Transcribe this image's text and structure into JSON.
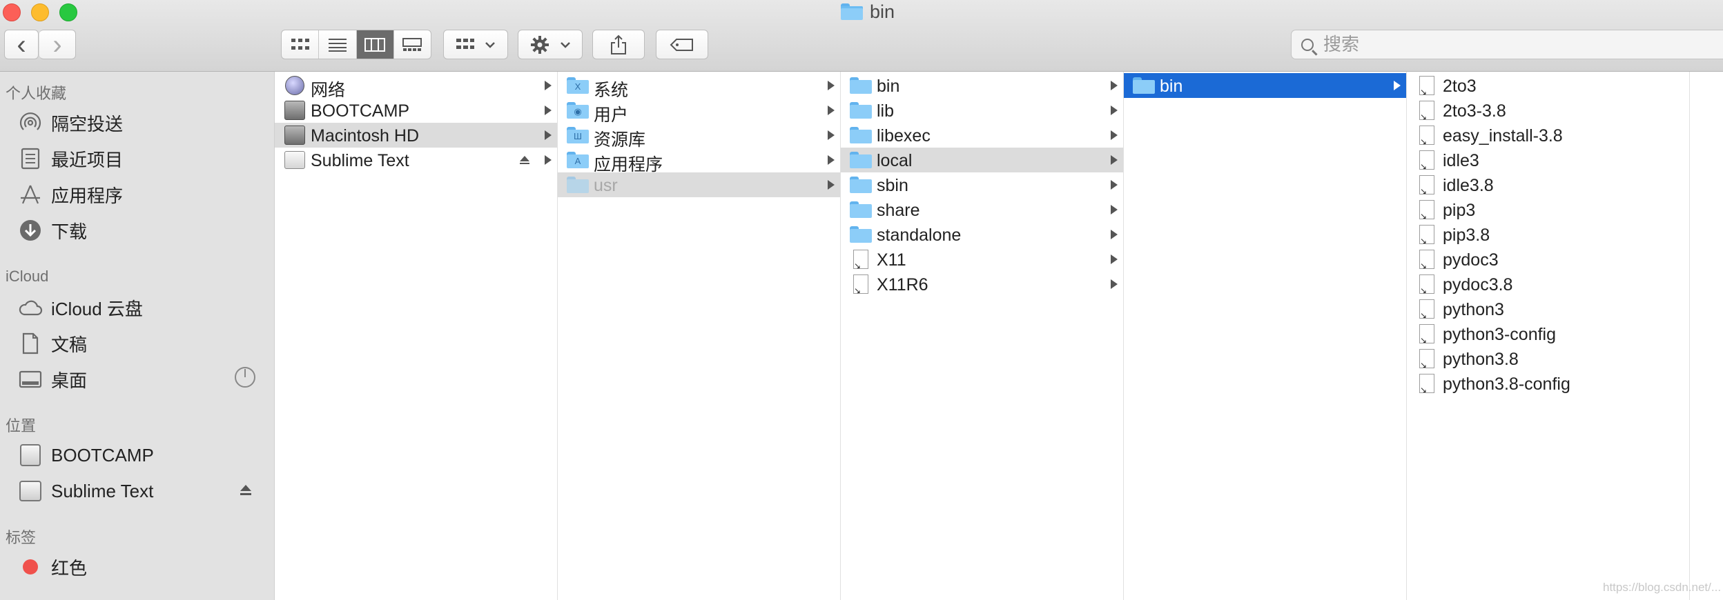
{
  "window": {
    "title": "bin"
  },
  "toolbar": {
    "back": "‹",
    "forward": "›",
    "search_placeholder": "搜索"
  },
  "sidebar": {
    "favorites_header": "个人收藏",
    "favorites": [
      "隔空投送",
      "最近项目",
      "应用程序",
      "下载"
    ],
    "icloud_header": "iCloud",
    "icloud": [
      "iCloud 云盘",
      "文稿",
      "桌面"
    ],
    "locations_header": "位置",
    "locations": [
      "BOOTCAMP",
      "Sublime Text"
    ],
    "tags_header": "标签",
    "tags": [
      "红色"
    ],
    "tag_colors": {
      "red": "#f0514c"
    }
  },
  "columns": {
    "col1": [
      "网络",
      "BOOTCAMP",
      "Macintosh HD",
      "Sublime Text"
    ],
    "col2": [
      "系统",
      "用户",
      "资源库",
      "应用程序",
      "usr"
    ],
    "col3": [
      "bin",
      "lib",
      "libexec",
      "local",
      "sbin",
      "share",
      "standalone",
      "X11",
      "X11R6"
    ],
    "col4": [
      "bin"
    ],
    "col5": [
      "2to3",
      "2to3-3.8",
      "easy_install-3.8",
      "idle3",
      "idle3.8",
      "pip3",
      "pip3.8",
      "pydoc3",
      "pydoc3.8",
      "python3",
      "python3-config",
      "python3.8",
      "python3.8-config"
    ]
  },
  "colors": {
    "selection_blue": "#1b6ad6",
    "selection_grey": "#dcdcdc",
    "folder_blue": "#8ccdf8"
  },
  "watermark": "https://blog.csdn.net/..."
}
